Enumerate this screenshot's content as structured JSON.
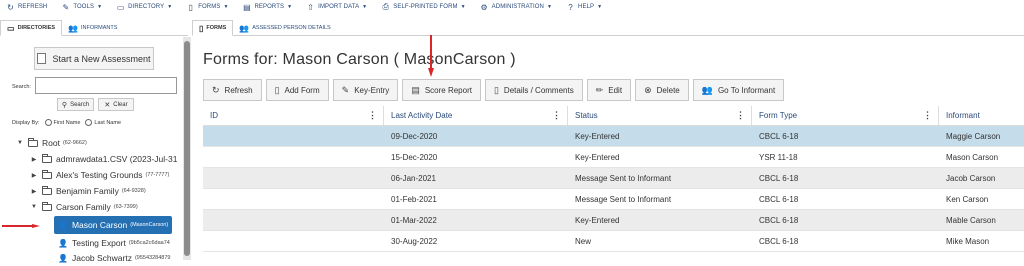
{
  "menubar": {
    "items": [
      {
        "label": "REFRESH",
        "icon": "refresh-icon",
        "caret": false
      },
      {
        "label": "TOOLS",
        "icon": "wrench-icon",
        "caret": true
      },
      {
        "label": "DIRECTORY",
        "icon": "folder-icon",
        "caret": true
      },
      {
        "label": "FORMS",
        "icon": "file-icon",
        "caret": true
      },
      {
        "label": "REPORTS",
        "icon": "report-icon",
        "caret": true
      },
      {
        "label": "IMPORT DATA",
        "icon": "upload-icon",
        "caret": true
      },
      {
        "label": "SELF-PRINTED FORM",
        "icon": "printer-icon",
        "caret": true
      },
      {
        "label": "ADMINISTRATION",
        "icon": "gear-icon",
        "caret": true
      },
      {
        "label": "HELP",
        "icon": "help-icon",
        "caret": true
      }
    ]
  },
  "left_tabs": {
    "directories": "DIRECTORIES",
    "informants": "INFORMANTS"
  },
  "right_tabs": {
    "forms": "FORMS",
    "assessed": "ASSESSED PERSON DETAILS"
  },
  "left_panel": {
    "start_button": "Start a New Assessment",
    "search_label": "Search:",
    "search_value": "",
    "search_button": "Search",
    "clear_button": "Clear",
    "display_by_label": "Display By:",
    "first_name": "First Name",
    "last_name": "Last Name"
  },
  "tree": {
    "root": {
      "label": "Root",
      "sub": "(62-9662)"
    },
    "items": [
      {
        "label": "admrawdata1.CSV (2023-Jul-31",
        "sub": ""
      },
      {
        "label": "Alex's Testing Grounds",
        "sub": "(77-7777)"
      },
      {
        "label": "Benjamin Family",
        "sub": "(64-9328)"
      },
      {
        "label": "Carson Family",
        "sub": "(63-7399)"
      }
    ],
    "people": [
      {
        "label": "Mason Carson",
        "sub": "(MasonCarson)"
      },
      {
        "label": "Testing Export",
        "sub": "(9b5ca2c6daa74"
      },
      {
        "label": "Jacob Schwartz",
        "sub": "(95543284879"
      }
    ]
  },
  "main": {
    "title": "Forms for:  Mason Carson  ( MasonCarson )",
    "toolbar": [
      {
        "label": "Refresh",
        "icon": "refresh-icon"
      },
      {
        "label": "Add Form",
        "icon": "add-file-icon"
      },
      {
        "label": "Key-Entry",
        "icon": "keyboard-icon"
      },
      {
        "label": "Score Report",
        "icon": "score-icon"
      },
      {
        "label": "Details / Comments",
        "icon": "file-icon"
      },
      {
        "label": "Edit",
        "icon": "pencil-icon"
      },
      {
        "label": "Delete",
        "icon": "delete-icon"
      },
      {
        "label": "Go To Informant",
        "icon": "users-icon"
      }
    ],
    "columns": [
      "ID",
      "Last Activity Date",
      "Status",
      "Form Type",
      "Informant"
    ],
    "rows": [
      {
        "id": "",
        "date": "09-Dec-2020",
        "status": "Key-Entered",
        "form": "CBCL 6-18",
        "informant": "Maggie Carson"
      },
      {
        "id": "",
        "date": "15-Dec-2020",
        "status": "Key-Entered",
        "form": "YSR 11-18",
        "informant": "Mason Carson"
      },
      {
        "id": "",
        "date": "06-Jan-2021",
        "status": "Message Sent to Informant",
        "form": "CBCL 6-18",
        "informant": "Jacob Carson"
      },
      {
        "id": "",
        "date": "01-Feb-2021",
        "status": "Message Sent to Informant",
        "form": "CBCL 6-18",
        "informant": "Ken Carson"
      },
      {
        "id": "",
        "date": "01-Mar-2022",
        "status": "Key-Entered",
        "form": "CBCL 6-18",
        "informant": "Mable Carson"
      },
      {
        "id": "",
        "date": "30-Aug-2022",
        "status": "New",
        "form": "CBCL 6-18",
        "informant": "Mike Mason"
      }
    ]
  },
  "colors": {
    "accent": "#2470b3",
    "selected_row": "#c5dcea",
    "annotation_arrow": "#d9262b"
  }
}
